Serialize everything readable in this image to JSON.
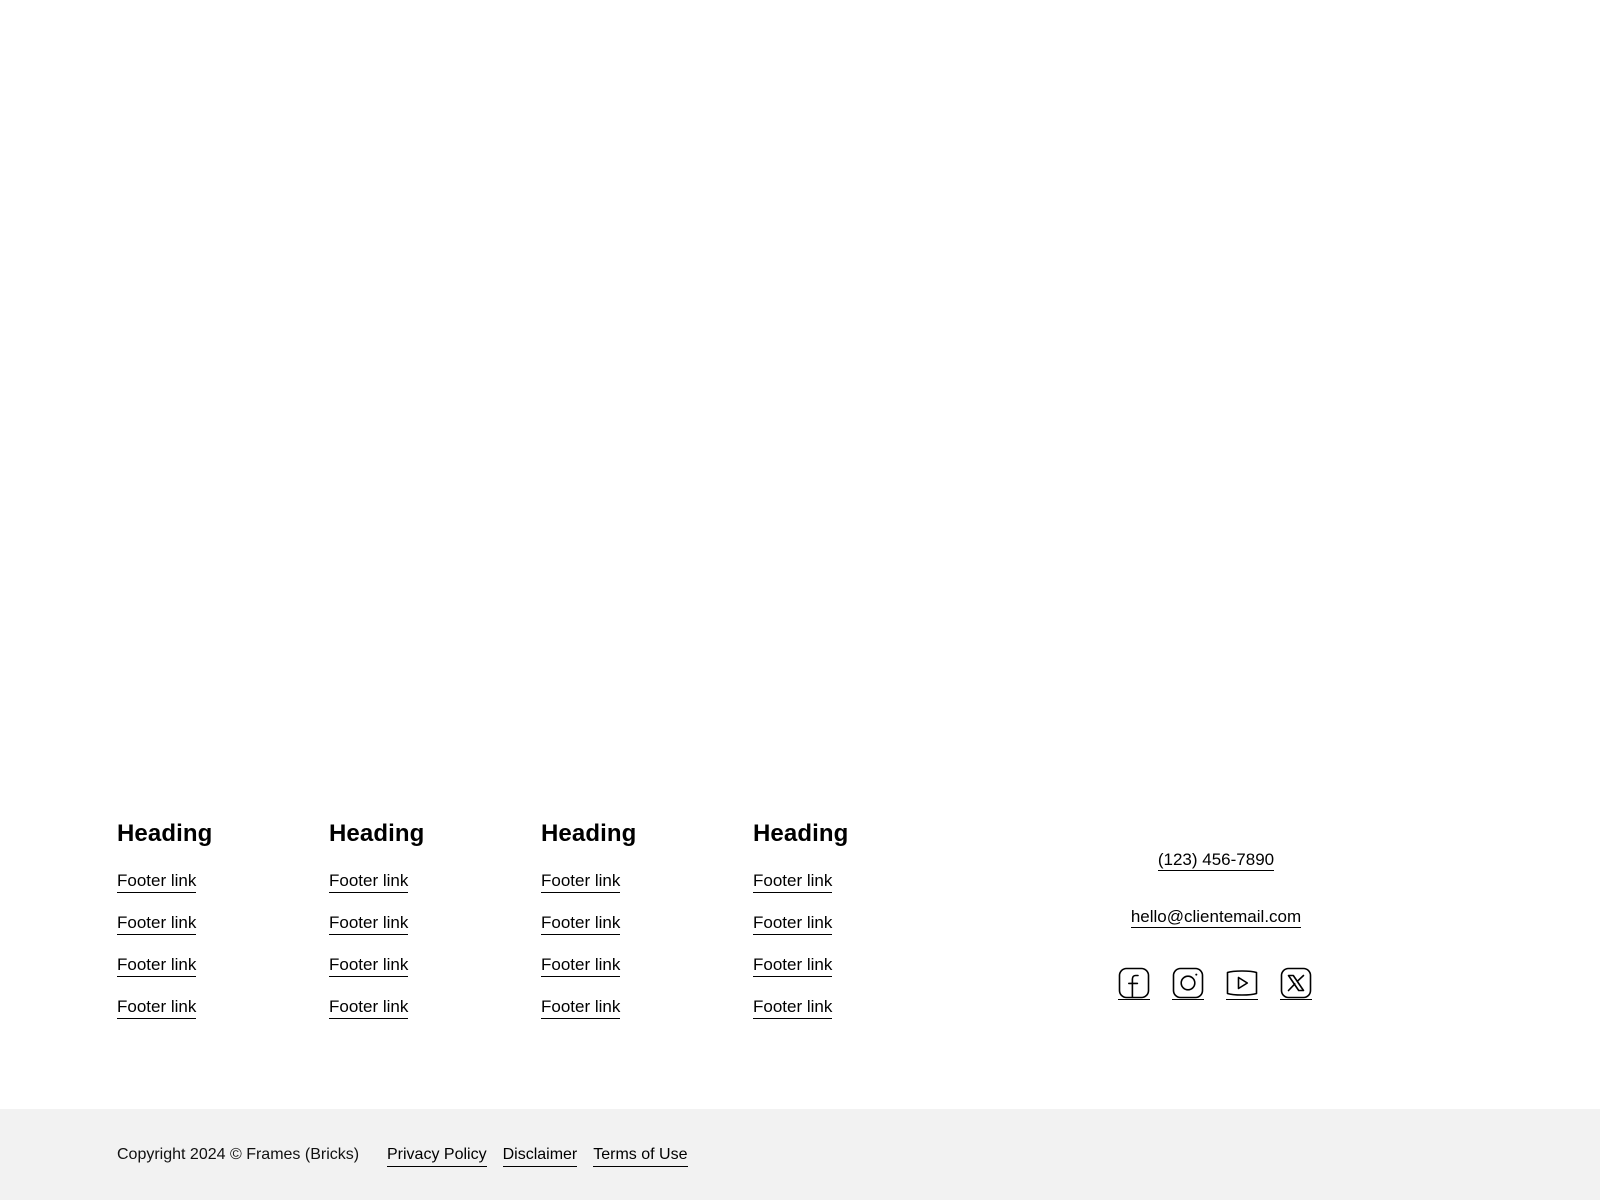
{
  "footer": {
    "columns": [
      {
        "heading": "Heading",
        "links": [
          "Footer link",
          "Footer link",
          "Footer link",
          "Footer link"
        ]
      },
      {
        "heading": "Heading",
        "links": [
          "Footer link",
          "Footer link",
          "Footer link",
          "Footer link"
        ]
      },
      {
        "heading": "Heading",
        "links": [
          "Footer link",
          "Footer link",
          "Footer link",
          "Footer link"
        ]
      },
      {
        "heading": "Heading",
        "links": [
          "Footer link",
          "Footer link",
          "Footer link",
          "Footer link"
        ]
      }
    ],
    "contact": {
      "phone": "(123) 456-7890",
      "email": "hello@clientemail.com"
    },
    "socials": [
      {
        "icon": "facebook-icon"
      },
      {
        "icon": "instagram-icon"
      },
      {
        "icon": "youtube-icon"
      },
      {
        "icon": "x-twitter-icon"
      }
    ]
  },
  "footer_bottom": {
    "copyright": "Copyright 2024 © Frames (Bricks)",
    "legal_links": [
      "Privacy Policy",
      "Disclaimer",
      "Terms of Use"
    ],
    "background": "#f2f2f2"
  }
}
